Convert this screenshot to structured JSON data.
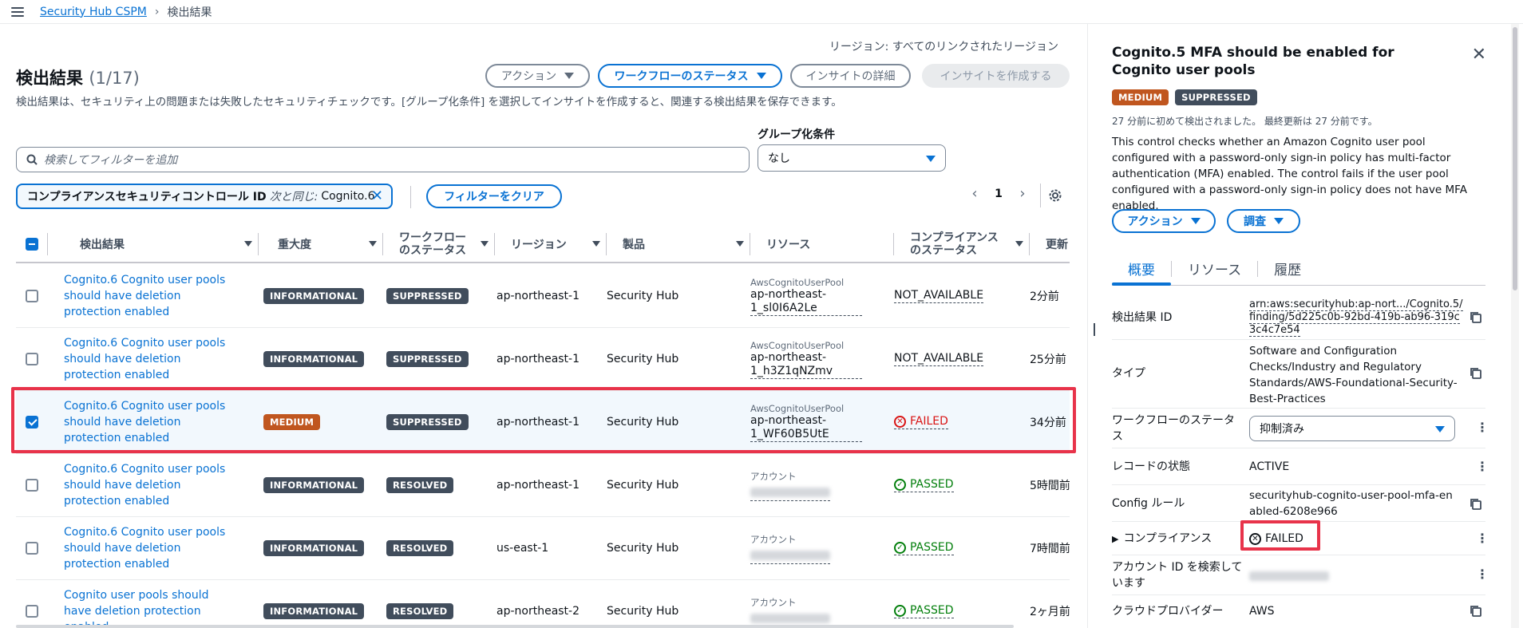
{
  "breadcrumb": {
    "root": "Security Hub CSPM",
    "current": "検出結果"
  },
  "header": {
    "region": "リージョン: すべてのリンクされたリージョン",
    "title": "検出結果",
    "count": "(1/17)",
    "description": "検出結果は、セキュリティ上の問題または失敗したセキュリティチェックです。[グループ化条件] を選択してインサイトを作成すると、関連する検出結果を保存できます。"
  },
  "toolbar": {
    "actions": "アクション",
    "workflow_status": "ワークフローのステータス",
    "insight_details": "インサイトの詳細",
    "create_insight": "インサイトを作成する"
  },
  "search": {
    "placeholder": "検索してフィルターを追加"
  },
  "group_by": {
    "label": "グループ化条件",
    "value": "なし"
  },
  "filter": {
    "field": "コンプライアンスセキュリティコントロール ID",
    "operator": "次と同じ:",
    "value": "Cognito.6",
    "clear_label": "フィルターをクリア"
  },
  "pagination": {
    "page": "1"
  },
  "table": {
    "columns": [
      "検出結果",
      "重大度",
      "ワークフロー\nのステータス",
      "リージョン",
      "製品",
      "リソース",
      "コンプライアンス\nのステータス",
      "更新日時"
    ],
    "rows": [
      {
        "finding": "Cognito.6 Cognito user pools should have deletion protection enabled",
        "severity": "INFORMATIONAL",
        "workflow": "SUPPRESSED",
        "region": "ap-northeast-1",
        "product": "Security Hub",
        "resource_type": "AwsCognitoUserPool",
        "resource_id": "ap-northeast-1_sl0I6A2Le",
        "compliance": "NOT_AVAILABLE",
        "updated": "2分前",
        "checked": false
      },
      {
        "finding": "Cognito.6 Cognito user pools should have deletion protection enabled",
        "severity": "INFORMATIONAL",
        "workflow": "SUPPRESSED",
        "region": "ap-northeast-1",
        "product": "Security Hub",
        "resource_type": "AwsCognitoUserPool",
        "resource_id": "ap-northeast-1_h3Z1qNZmv",
        "compliance": "NOT_AVAILABLE",
        "updated": "25分前",
        "checked": false
      },
      {
        "finding": "Cognito.6 Cognito user pools should have deletion protection enabled",
        "severity": "MEDIUM",
        "workflow": "SUPPRESSED",
        "region": "ap-northeast-1",
        "product": "Security Hub",
        "resource_type": "AwsCognitoUserPool",
        "resource_id": "ap-northeast-1_WF60B5UtE",
        "compliance": "FAILED",
        "updated": "34分前",
        "checked": true
      },
      {
        "finding": "Cognito.6 Cognito user pools should have deletion protection enabled",
        "severity": "INFORMATIONAL",
        "workflow": "RESOLVED",
        "region": "ap-northeast-1",
        "product": "Security Hub",
        "resource_type": "アカウント",
        "resource_id": "",
        "compliance": "PASSED",
        "updated": "5時間前",
        "checked": false
      },
      {
        "finding": "Cognito.6 Cognito user pools should have deletion protection enabled",
        "severity": "INFORMATIONAL",
        "workflow": "RESOLVED",
        "region": "us-east-1",
        "product": "Security Hub",
        "resource_type": "アカウント",
        "resource_id": "",
        "compliance": "PASSED",
        "updated": "7時間前",
        "checked": false
      },
      {
        "finding": "Cognito user pools should have deletion protection enabled",
        "severity": "INFORMATIONAL",
        "workflow": "RESOLVED",
        "region": "ap-northeast-2",
        "product": "Security Hub",
        "resource_type": "アカウント",
        "resource_id": "",
        "compliance": "PASSED",
        "updated": "2ヶ月前",
        "checked": false
      }
    ]
  },
  "panel": {
    "title": "Cognito.5 MFA should be enabled for Cognito user pools",
    "severity": "MEDIUM",
    "workflow": "SUPPRESSED",
    "times": "27 分前に初めて検出されました。 最終更新は 27 分前です。",
    "description": "This control checks whether an Amazon Cognito user pool configured with a password-only sign-in policy has multi-factor authentication (MFA) enabled. The control fails if the user pool configured with a password-only sign-in policy does not have MFA enabled.",
    "actions": "アクション",
    "investigate": "調査",
    "tabs": [
      "概要",
      "リソース",
      "履歴"
    ],
    "fields": {
      "finding_id_label": "検出結果 ID",
      "finding_id": "arn:aws:securityhub:ap-nort.../Cognito.5/finding/5d225c0b-92bd-419b-ab96-319c3c4c7e54",
      "type_label": "タイプ",
      "type": "Software and Configuration Checks/Industry and Regulatory Standards/AWS-Foundational-Security-Best-Practices",
      "workflow_label": "ワークフローのステータス",
      "workflow_value": "抑制済み",
      "record_label": "レコードの状態",
      "record": "ACTIVE",
      "config_label": "Config ルール",
      "config": "securityhub-cognito-user-pool-mfa-enabled-6208e966",
      "compliance_label": "コンプライアンス",
      "compliance": "FAILED",
      "account_label": "アカウント ID を検索しています",
      "cloud_label": "クラウドプロバイダー",
      "cloud": "AWS"
    }
  },
  "colors": {
    "accent": "#0972d3",
    "failed": "#d91515",
    "passed": "#037f0c",
    "medium": "#c0561f",
    "highlight": "#e8334a"
  }
}
